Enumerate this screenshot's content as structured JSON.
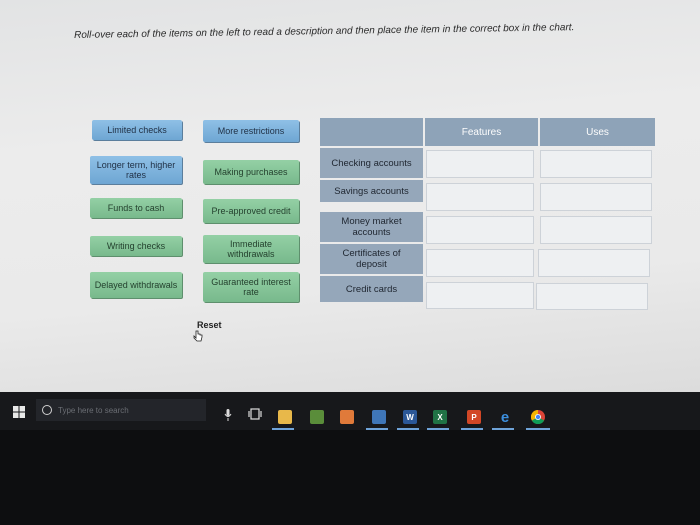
{
  "instructions": "Roll-over each of the items on the left to read a description  and then place the item in the correct box in the chart.",
  "items_left": [
    {
      "label": "Limited checks"
    },
    {
      "label": "Longer term, higher rates"
    },
    {
      "label": "Funds to cash"
    },
    {
      "label": "Writing checks"
    },
    {
      "label": "Delayed withdrawals"
    }
  ],
  "items_right": [
    {
      "label": "More restrictions"
    },
    {
      "label": "Making purchases"
    },
    {
      "label": "Pre-approved credit"
    },
    {
      "label": "Immediate withdrawals"
    },
    {
      "label": "Guaranteed interest rate"
    }
  ],
  "chart": {
    "headers": [
      "",
      "Features",
      "Uses"
    ],
    "rows": [
      {
        "label": "Checking accounts"
      },
      {
        "label": "Savings accounts"
      },
      {
        "label": "Money market accounts"
      },
      {
        "label": "Certificates of deposit"
      },
      {
        "label": "Credit cards"
      }
    ]
  },
  "reset_label": "Reset",
  "taskbar": {
    "search_placeholder": "Type here to search",
    "word_icon_letter": "W",
    "excel_icon_letter": "X",
    "powerpoint_icon_letter": "P",
    "edge_icon_letter": "e"
  },
  "colors": {
    "blue_card": "#7fb3dd",
    "green_card": "#86c598",
    "chart_header": "#8ea3b8",
    "taskbar": "#17181b"
  }
}
